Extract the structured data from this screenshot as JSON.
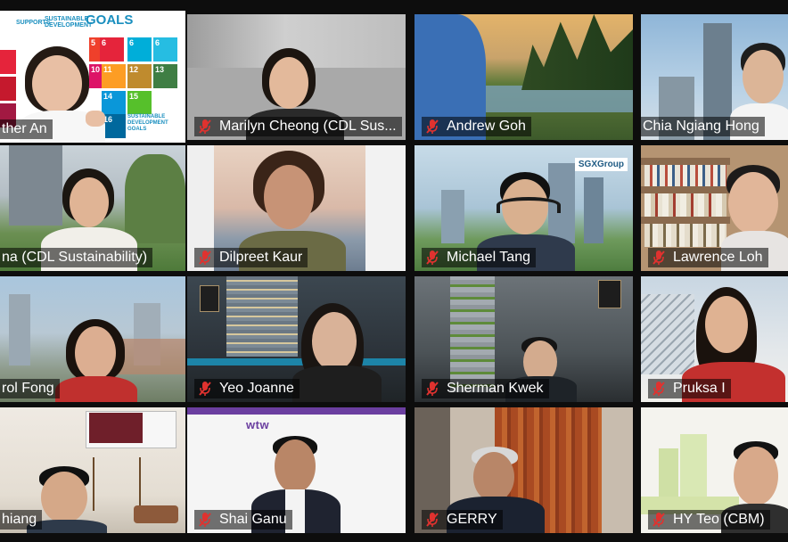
{
  "meeting": {
    "participants": [
      {
        "display_name": "ther An",
        "muted": false,
        "speaking": true
      },
      {
        "display_name": "Marilyn Cheong (CDL Sus...",
        "muted": true
      },
      {
        "display_name": "Andrew Goh",
        "muted": true
      },
      {
        "display_name": "Chia Ngiang Hong",
        "muted": false
      },
      {
        "display_name": "na (CDL Sustainability)",
        "muted": false
      },
      {
        "display_name": "Dilpreet Kaur",
        "muted": true
      },
      {
        "display_name": "Michael Tang",
        "muted": true
      },
      {
        "display_name": "Lawrence Loh",
        "muted": true
      },
      {
        "display_name": "rol Fong",
        "muted": false
      },
      {
        "display_name": "Yeo Joanne",
        "muted": true
      },
      {
        "display_name": "Sherman Kwek",
        "muted": true
      },
      {
        "display_name": "Pruksa I",
        "muted": true
      },
      {
        "display_name": "hiang",
        "muted": false
      },
      {
        "display_name": "Shai Ganu",
        "muted": true
      },
      {
        "display_name": "GERRY",
        "muted": true
      },
      {
        "display_name": "HY Teo (CBM)",
        "muted": true
      }
    ]
  },
  "backgrounds": {
    "sdg": {
      "supports_text": "SUPPORTS",
      "title_line1": "SUSTAINABLE",
      "title_line2": "DEVELOPMENT",
      "goals_text": "GOALS",
      "tile_numbers": [
        "5",
        "6",
        "10",
        "11",
        "12",
        "13",
        "14",
        "15",
        "16"
      ],
      "goals_small": "SUSTAINABLE DEVELOPMENT GOALS"
    },
    "sgx": {
      "logo_text": "SGXGroup"
    },
    "wtw": {
      "logo_text": "wtw"
    }
  },
  "colors": {
    "active_speaker_border": "#d7ee3a",
    "muted_icon": "#e0322f",
    "name_text": "#ffffff"
  }
}
